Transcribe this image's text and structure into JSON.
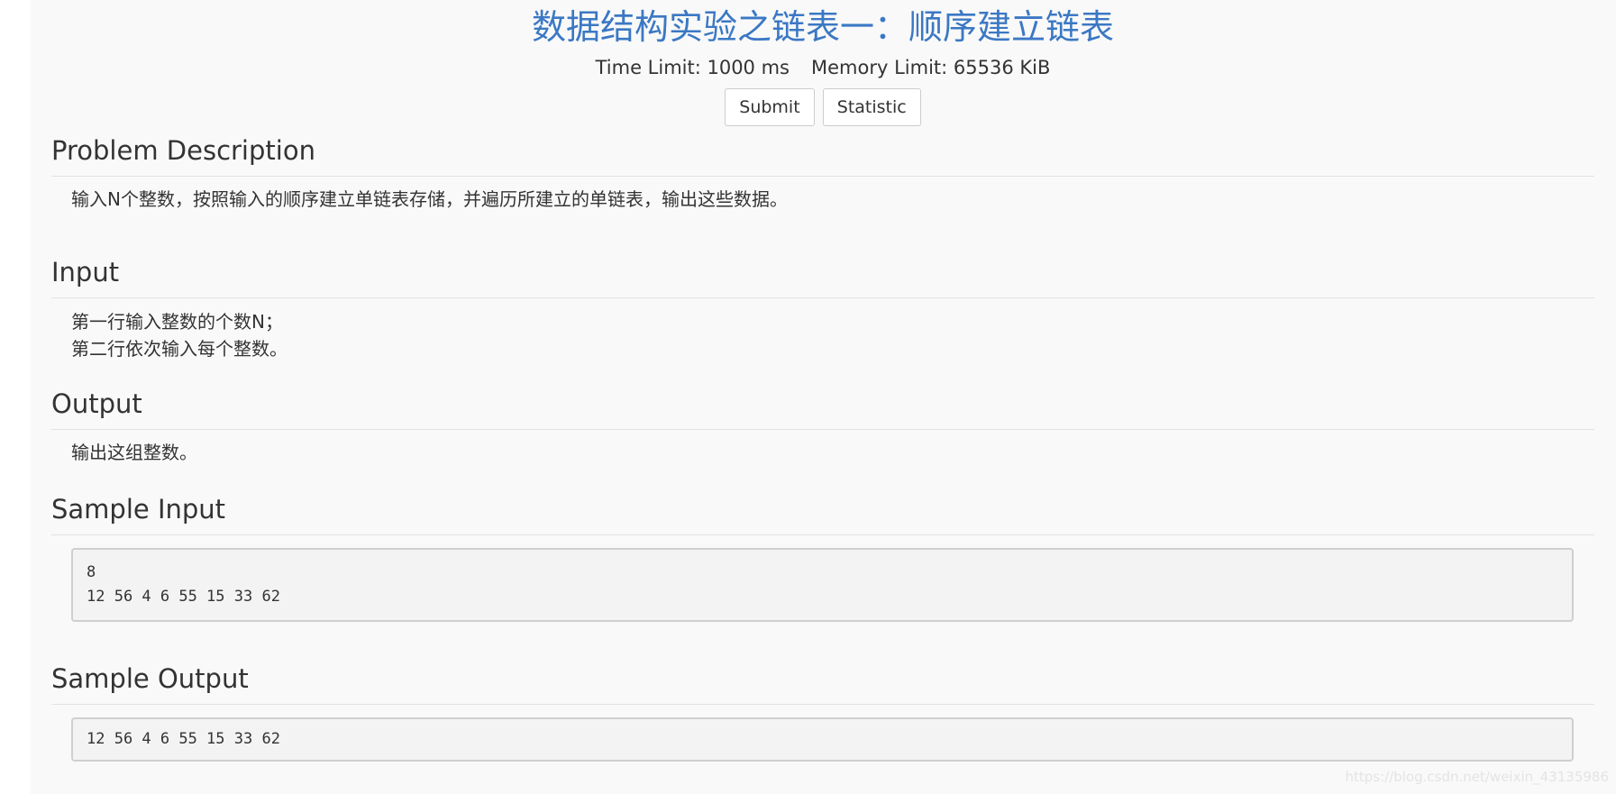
{
  "problem": {
    "title": "数据结构实验之链表一：顺序建立链表",
    "time_limit": "Time Limit: 1000 ms",
    "memory_limit": "Memory Limit: 65536 KiB"
  },
  "actions": {
    "submit_label": "Submit",
    "statistic_label": "Statistic"
  },
  "sections": {
    "description": {
      "heading": "Problem Description",
      "text": "输入N个整数，按照输入的顺序建立单链表存储，并遍历所建立的单链表，输出这些数据。"
    },
    "input": {
      "heading": "Input",
      "lines": [
        "第一行输入整数的个数N；",
        "第二行依次输入每个整数。"
      ]
    },
    "output": {
      "heading": "Output",
      "text": "输出这组整数。"
    },
    "sample_input": {
      "heading": "Sample Input",
      "text": "8\n12 56 4 6 55 15 33 62"
    },
    "sample_output": {
      "heading": "Sample Output",
      "text": "12 56 4 6 55 15 33 62"
    }
  },
  "watermark": "https://blog.csdn.net/weixin_43135986"
}
